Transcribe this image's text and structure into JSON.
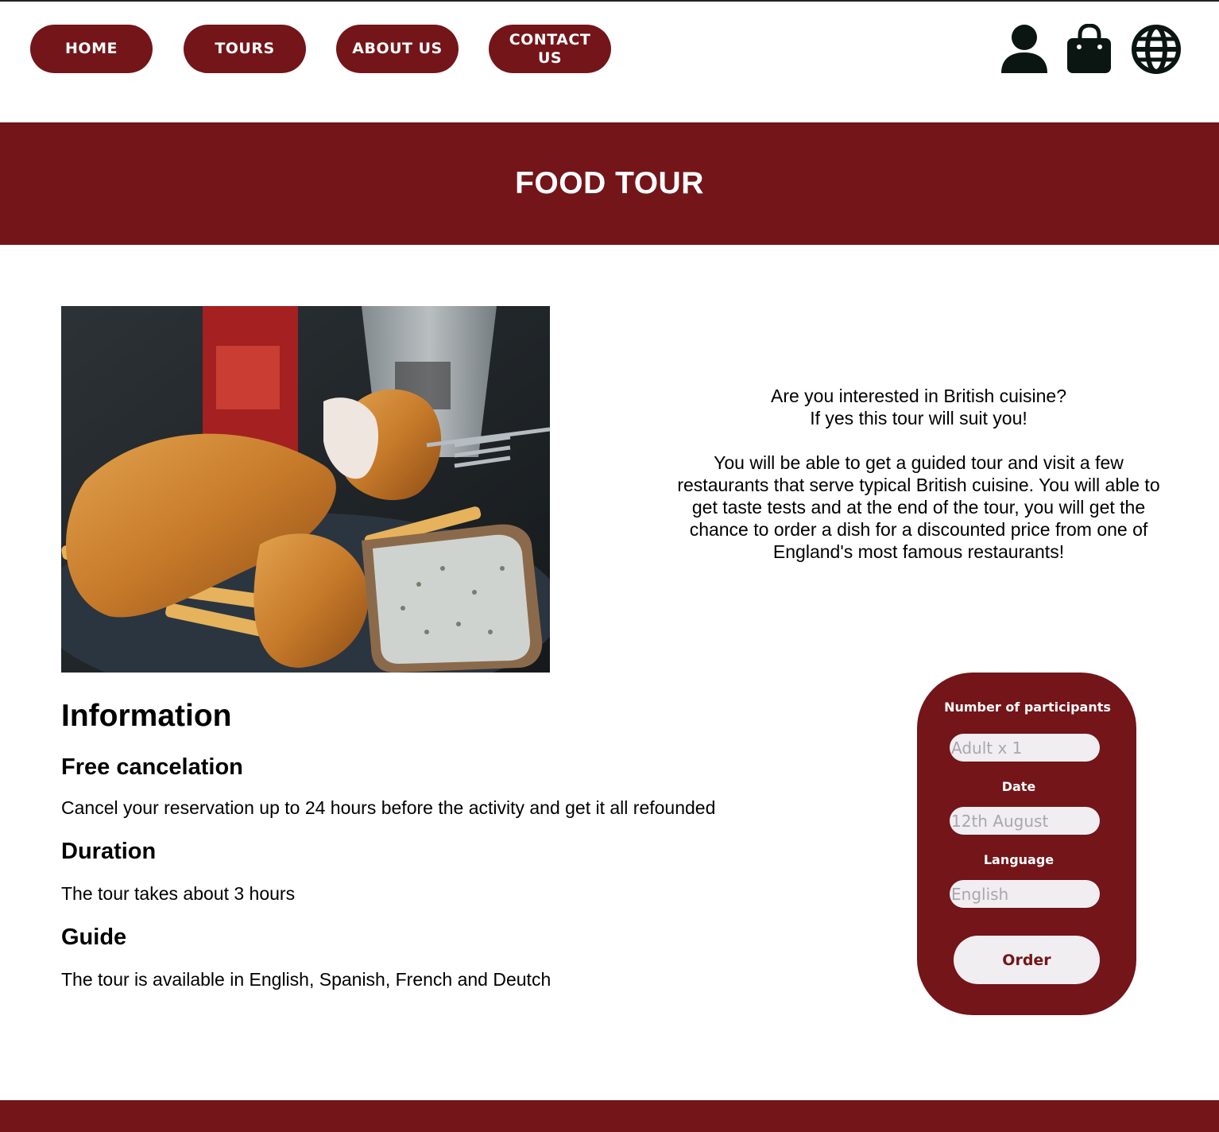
{
  "nav": {
    "home": "HOME",
    "tours": "TOURS",
    "about": "ABOUT US",
    "contact": "CONTACT US"
  },
  "icons": {
    "user": "user-icon",
    "bag": "shopping-bag-icon",
    "globe": "globe-icon"
  },
  "banner": {
    "title": "FOOD TOUR"
  },
  "description": {
    "intro": "Are you interested in British cuisine?\nIf yes this tour will suit you!",
    "body": "You will be able to get a guided tour and visit a few restaurants that serve typical British cuisine. You will able to get taste tests and at the end of the tour, you will get the chance to order a dish for a discounted price from one of England's most famous restaurants!"
  },
  "info": {
    "heading": "Information",
    "cancel_title": "Free cancelation",
    "cancel_text": "Cancel your reservation up to 24 hours before the activity and get it all refounded",
    "duration_title": "Duration",
    "duration_text": "The tour takes about 3 hours",
    "guide_title": "Guide",
    "guide_text": "The tour is available in English, Spanish, French and Deutch"
  },
  "order": {
    "participants_label": "Number of participants",
    "participants_placeholder": "Adult x 1",
    "date_label": "Date",
    "date_placeholder": "12th August",
    "language_label": "Language",
    "language_placeholder": "English",
    "button": "Order"
  },
  "colors": {
    "brand": "#731519",
    "light": "#f1eef2"
  }
}
